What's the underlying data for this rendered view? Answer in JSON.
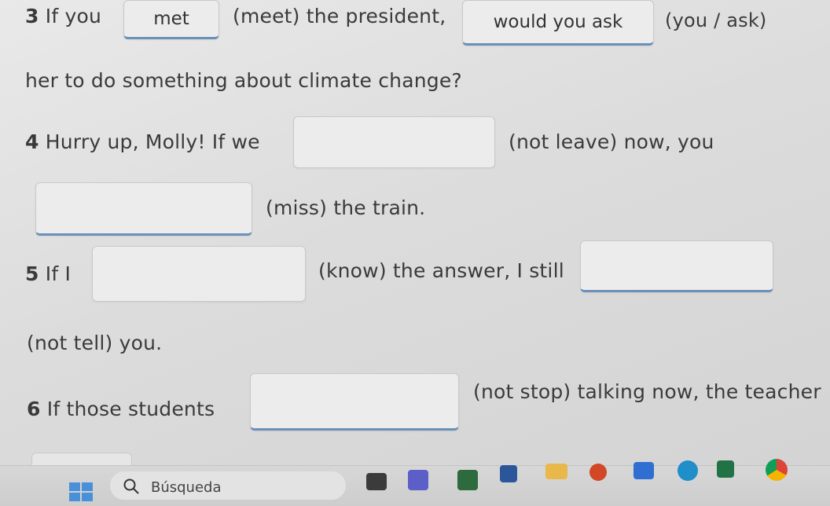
{
  "q3": {
    "number": "3",
    "text_before": "If you",
    "answer1": "met",
    "mid": "(meet) the president,",
    "answer2": "would you ask",
    "hint2": "(you / ask)",
    "line2": "her to do something about climate change?"
  },
  "q4": {
    "number": "4",
    "text_before": "Hurry up, Molly! If we",
    "answer1": "",
    "hint1": "(not leave) now, you",
    "answer2": "",
    "hint2": "(miss) the train."
  },
  "q5": {
    "number": "5",
    "text_before": "If I",
    "answer1": "",
    "hint1": "(know) the answer, I still",
    "answer2": "",
    "hint2": "(not tell) you."
  },
  "q6": {
    "number": "6",
    "text_before": "If those students",
    "answer1": "",
    "hint1": "(not stop) talking now, the teacher"
  },
  "taskbar": {
    "search_placeholder": "Búsqueda",
    "icons": [
      "windows-start-icon",
      "search-icon",
      "file-explorer-icon",
      "teams-icon",
      "calculator-icon",
      "word-icon",
      "folder-icon",
      "powerpoint-icon",
      "edge-icon",
      "chrome-like-icon",
      "excel-icon",
      "chrome-icon"
    ]
  }
}
